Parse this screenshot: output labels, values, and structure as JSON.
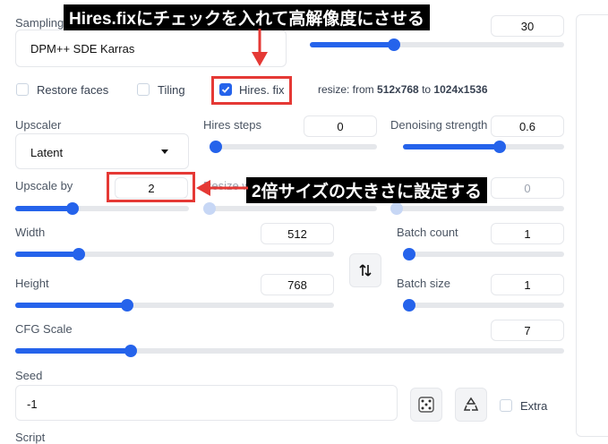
{
  "sampling": {
    "label": "Sampling",
    "value": "DPM++ SDE Karras"
  },
  "steps": {
    "value": "30",
    "fraction": 0.33
  },
  "checkboxes": {
    "restore_faces": {
      "label": "Restore faces",
      "checked": false
    },
    "tiling": {
      "label": "Tiling",
      "checked": false
    },
    "hires_fix": {
      "label": "Hires. fix",
      "checked": true
    }
  },
  "resize": {
    "prefix": "resize: from ",
    "from": "512x768",
    "mid": " to ",
    "to": "1024x1536"
  },
  "upscaler": {
    "label": "Upscaler",
    "value": "Latent"
  },
  "hires_steps": {
    "label": "Hires steps",
    "value": "0",
    "fraction": 0.0
  },
  "denoising": {
    "label": "Denoising strength",
    "value": "0.6",
    "fraction": 0.6
  },
  "upscale_by": {
    "label": "Upscale by",
    "value": "2",
    "fraction": 0.33
  },
  "resize_width": {
    "label": "Resize w",
    "value": "0"
  },
  "resize_height": {
    "value": "0"
  },
  "width": {
    "label": "Width",
    "value": "512",
    "fraction": 0.2
  },
  "height": {
    "label": "Height",
    "value": "768",
    "fraction": 0.35
  },
  "batch_count": {
    "label": "Batch count",
    "value": "1",
    "fraction": 0.0
  },
  "batch_size": {
    "label": "Batch size",
    "value": "1",
    "fraction": 0.0
  },
  "cfg_scale": {
    "label": "CFG Scale",
    "value": "7",
    "fraction": 0.21
  },
  "seed": {
    "label": "Seed",
    "value": "-1"
  },
  "extra": {
    "label": "Extra",
    "checked": false
  },
  "script": {
    "label": "Script"
  },
  "annotations": {
    "top": "Hires.fixにチェックを入れて高解像度にさせる",
    "middle": "2倍サイズの大きさに設定する"
  },
  "colors": {
    "accent": "#2563eb",
    "annotation_red": "#e53935"
  }
}
